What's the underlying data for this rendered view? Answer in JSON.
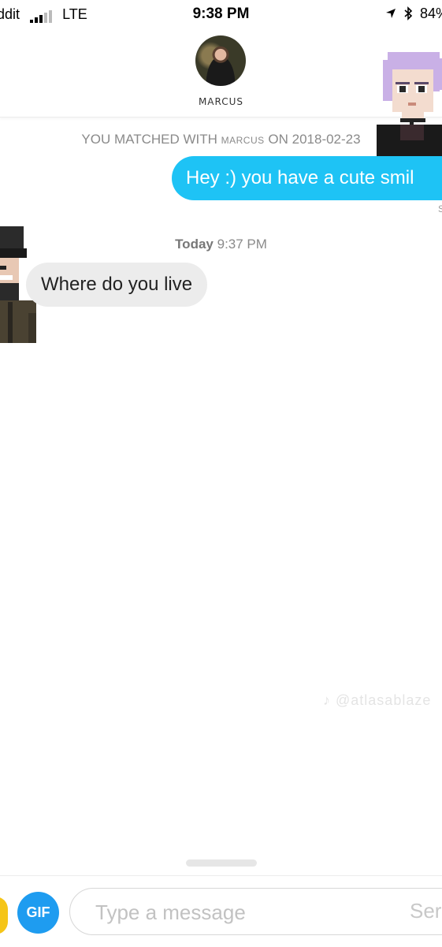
{
  "status_bar": {
    "carrier": "ddit",
    "network": "LTE",
    "time": "9:38 PM",
    "battery": "84%"
  },
  "header": {
    "name": "MARCUS"
  },
  "conversation": {
    "match_prefix": "YOU MATCHED WITH",
    "match_name": "MARCUS",
    "match_middle": "ON",
    "match_date": "2018-02-23",
    "outgoing_message": "Hey :) you have a cute smil",
    "outgoing_status": "S",
    "date_divider_day": "Today",
    "date_divider_time": "9:37 PM",
    "incoming_message": "Where do you live"
  },
  "watermark": "@atlasablaze",
  "composer": {
    "gif_label": "GIF",
    "placeholder": "Type a message",
    "send_label": "Ser"
  },
  "colors": {
    "outgoing_bubble": "#1ec3f5",
    "incoming_bubble": "#ececec",
    "gif_button": "#1e9cf0",
    "emoji_button": "#f5c518"
  }
}
